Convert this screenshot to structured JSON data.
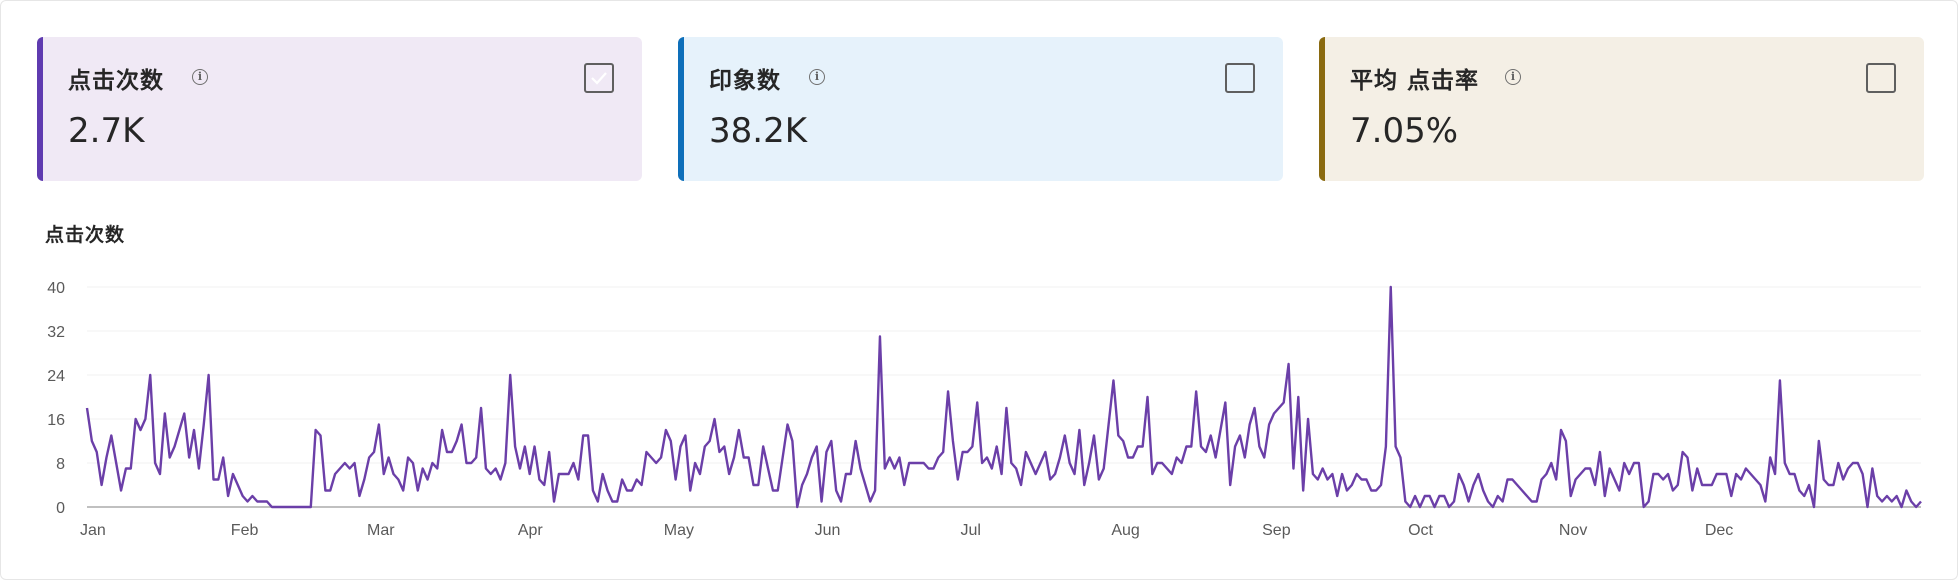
{
  "cards": [
    {
      "title": "点击次数",
      "value": "2.7K",
      "checked": true,
      "accent": "#5f3bb0",
      "bg": "#f0e9f5"
    },
    {
      "title": "印象数",
      "value": "38.2K",
      "checked": false,
      "accent": "#0e6fba",
      "bg": "#e6f2fb"
    },
    {
      "title": "平均 点击率",
      "value": "7.05%",
      "checked": false,
      "accent": "#8a6a10",
      "bg": "#f4efe5"
    }
  ],
  "info_glyph": "i",
  "chart_data": {
    "type": "line",
    "title": "点击次数",
    "xlabel": "",
    "ylabel": "",
    "ylim": [
      0,
      40
    ],
    "yticks": [
      0,
      8,
      16,
      24,
      32,
      40
    ],
    "month_ticks": [
      "Jan",
      "Feb",
      "Mar",
      "Apr",
      "May",
      "Jun",
      "Jul",
      "Aug",
      "Sep",
      "Oct",
      "Nov",
      "Dec"
    ],
    "month_start_days": [
      0,
      31,
      59,
      90,
      120,
      151,
      181,
      212,
      243,
      273,
      304,
      334
    ],
    "color": "#6b3fa8",
    "grid": true,
    "series": [
      {
        "values": [
          18,
          12,
          10,
          4,
          9,
          13,
          8,
          3,
          7,
          7,
          16,
          14,
          16,
          24,
          8,
          6,
          17,
          9,
          11,
          14,
          17,
          9,
          14,
          7,
          15,
          24,
          5,
          5,
          9,
          2,
          6,
          4,
          2,
          1,
          2,
          1,
          1,
          1,
          0,
          0,
          0,
          0,
          0,
          0,
          0,
          0,
          0,
          14,
          13,
          3,
          3,
          6,
          7,
          8,
          7,
          8,
          2,
          5,
          9,
          10,
          15,
          6,
          9,
          6,
          5,
          3,
          9,
          8,
          3,
          7,
          5,
          8,
          7,
          14,
          10,
          10,
          12,
          15,
          8,
          8,
          9,
          18,
          7,
          6,
          7,
          5,
          8,
          24,
          11,
          7,
          11,
          6,
          11,
          5,
          4,
          10,
          1,
          6,
          6,
          6,
          8,
          5,
          13,
          13,
          3,
          1,
          6,
          3,
          1,
          1,
          5,
          3,
          3,
          5,
          4,
          10,
          9,
          8,
          9,
          14,
          12,
          5,
          11,
          13,
          3,
          8,
          6,
          11,
          12,
          16,
          10,
          11,
          6,
          9,
          14,
          9,
          9,
          4,
          4,
          11,
          7,
          3,
          3,
          9,
          15,
          12,
          0,
          4,
          6,
          9,
          11,
          1,
          10,
          12,
          3,
          1,
          6,
          6,
          12,
          7,
          4,
          1,
          3,
          31,
          7,
          9,
          7,
          9,
          4,
          8,
          8,
          8,
          8,
          7,
          7,
          9,
          10,
          21,
          12,
          5,
          10,
          10,
          11,
          19,
          8,
          9,
          7,
          11,
          6,
          18,
          8,
          7,
          4,
          10,
          8,
          6,
          8,
          10,
          5,
          6,
          9,
          13,
          8,
          6,
          14,
          4,
          8,
          13,
          5,
          7,
          15,
          23,
          13,
          12,
          9,
          9,
          11,
          11,
          20,
          6,
          8,
          8,
          7,
          6,
          9,
          8,
          11,
          11,
          21,
          11,
          10,
          13,
          9,
          14,
          19,
          4,
          11,
          13,
          9,
          15,
          18,
          11,
          9,
          15,
          17,
          18,
          19,
          26,
          7,
          20,
          3,
          16,
          6,
          5,
          7,
          5,
          6,
          2,
          6,
          3,
          4,
          6,
          5,
          5,
          3,
          3,
          4,
          11,
          40,
          11,
          9,
          1,
          0,
          2,
          0,
          2,
          2,
          0,
          2,
          2,
          0,
          1,
          6,
          4,
          1,
          4,
          6,
          3,
          1,
          0,
          2,
          1,
          5,
          5,
          4,
          3,
          2,
          1,
          1,
          5,
          6,
          8,
          5,
          14,
          12,
          2,
          5,
          6,
          7,
          7,
          4,
          10,
          2,
          7,
          5,
          3,
          8,
          6,
          8,
          8,
          0,
          1,
          6,
          6,
          5,
          6,
          3,
          4,
          10,
          9,
          3,
          7,
          4,
          4,
          4,
          6,
          6,
          6,
          2,
          6,
          5,
          7,
          6,
          5,
          4,
          1,
          9,
          6,
          23,
          8,
          6,
          6,
          3,
          2,
          4,
          0,
          12,
          5,
          4,
          4,
          8,
          5,
          7,
          8,
          8,
          6,
          0,
          7,
          2,
          1,
          2,
          1,
          2,
          0,
          3,
          1,
          0,
          1
        ]
      }
    ]
  }
}
